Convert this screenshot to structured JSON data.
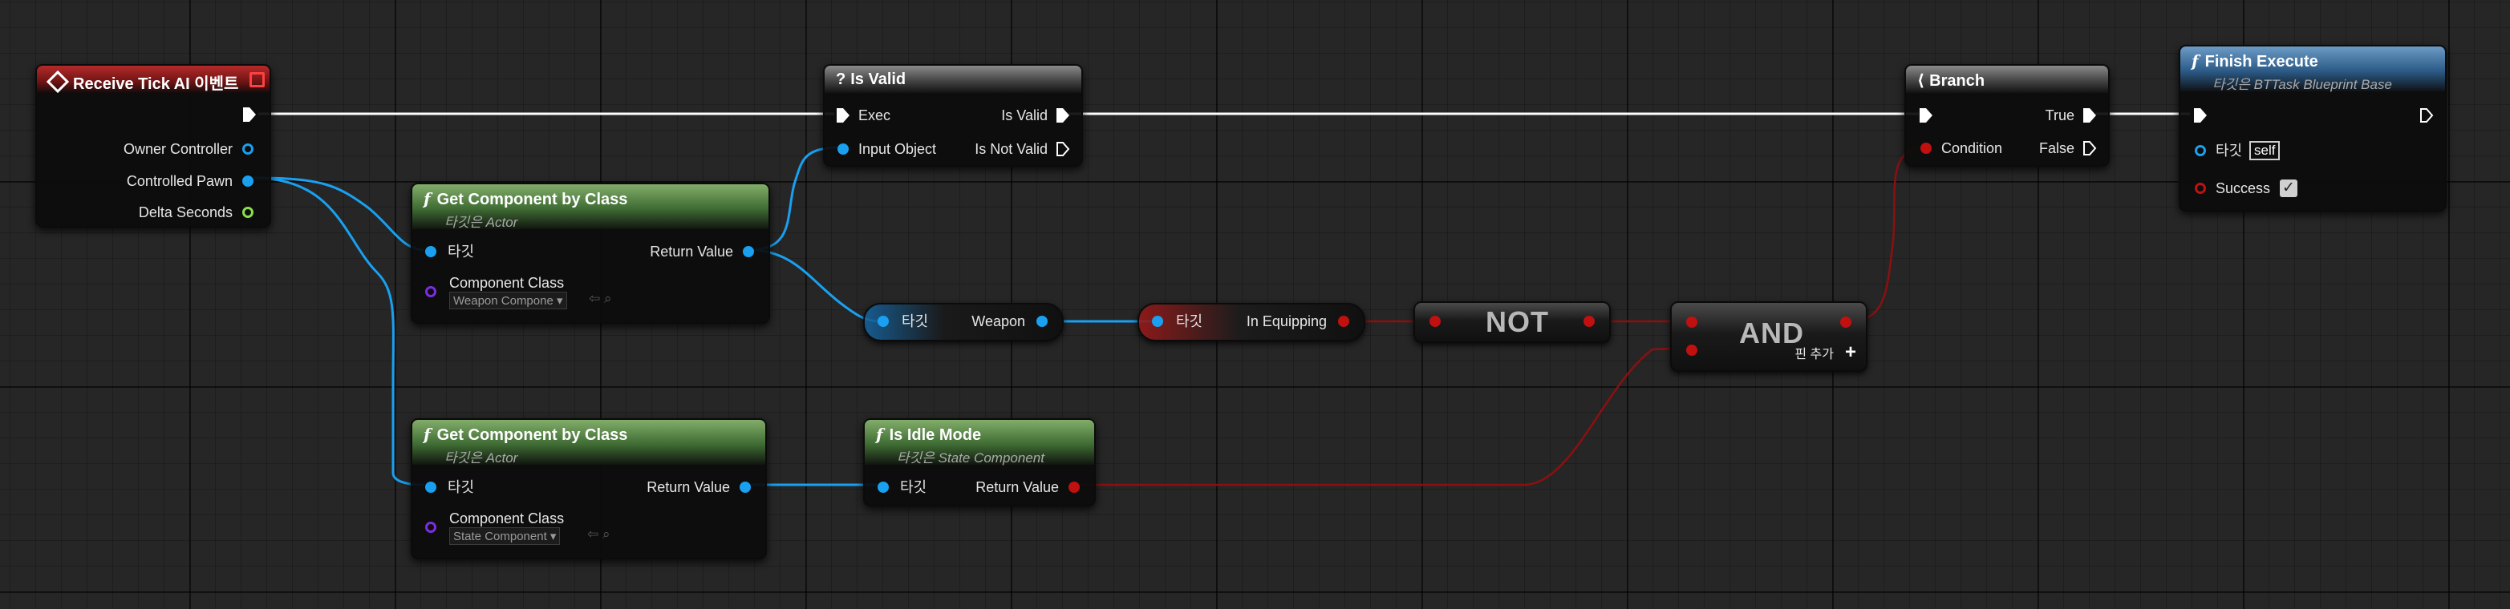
{
  "nodes": {
    "receive_tick": {
      "title": "Receive Tick AI 이벤트",
      "pins": {
        "owner_controller": "Owner Controller",
        "controlled_pawn": "Controlled Pawn",
        "delta_seconds": "Delta Seconds"
      }
    },
    "is_valid": {
      "title": "Is Valid",
      "pins": {
        "exec": "Exec",
        "input_object": "Input Object",
        "is_valid": "Is Valid",
        "is_not_valid": "Is Not Valid"
      }
    },
    "branch": {
      "title": "Branch",
      "pins": {
        "condition": "Condition",
        "true": "True",
        "false": "False"
      }
    },
    "finish_execute": {
      "title": "Finish Execute",
      "subtitle": "타깃은 BTTask Blueprint Base",
      "pins": {
        "target": "타깃",
        "target_value": "self",
        "success": "Success"
      },
      "success_checked": true
    },
    "get_component_weapon": {
      "title": "Get Component by Class",
      "subtitle": "타깃은 Actor",
      "pins": {
        "target": "타깃",
        "return_value": "Return Value",
        "component_class": "Component Class"
      },
      "component_class_value": "Weapon Compone"
    },
    "get_component_state": {
      "title": "Get Component by Class",
      "subtitle": "타깃은 Actor",
      "pins": {
        "target": "타깃",
        "return_value": "Return Value",
        "component_class": "Component Class"
      },
      "component_class_value": "State Component"
    },
    "weapon_getter": {
      "target": "타깃",
      "output": "Weapon"
    },
    "in_equipping_getter": {
      "target": "타깃",
      "output": "In Equipping"
    },
    "not_node": {
      "label": "NOT"
    },
    "and_node": {
      "label": "AND",
      "add_pin": "핀 추가"
    },
    "is_idle_mode": {
      "title": "Is Idle Mode",
      "subtitle": "타깃은 State Component",
      "pins": {
        "target": "타깃",
        "return_value": "Return Value"
      }
    }
  },
  "colors": {
    "exec_wire": "#ffffff",
    "object_wire": "#19a0f0",
    "bool_wire": "#8b1010",
    "float_pin": "#8ae04c",
    "class_pin": "#7a2ee0",
    "event_header": "#b42a2a",
    "pure_header": "#3e6b33",
    "target_header": "#2b5a87"
  },
  "icons": {
    "event": "event-diamond-icon",
    "function": "function-f-icon",
    "macro": "question-mark-icon",
    "branch": "branch-icon",
    "add_pin": "plus-icon",
    "browse": "arrow-left-icon",
    "search": "search-icon"
  }
}
